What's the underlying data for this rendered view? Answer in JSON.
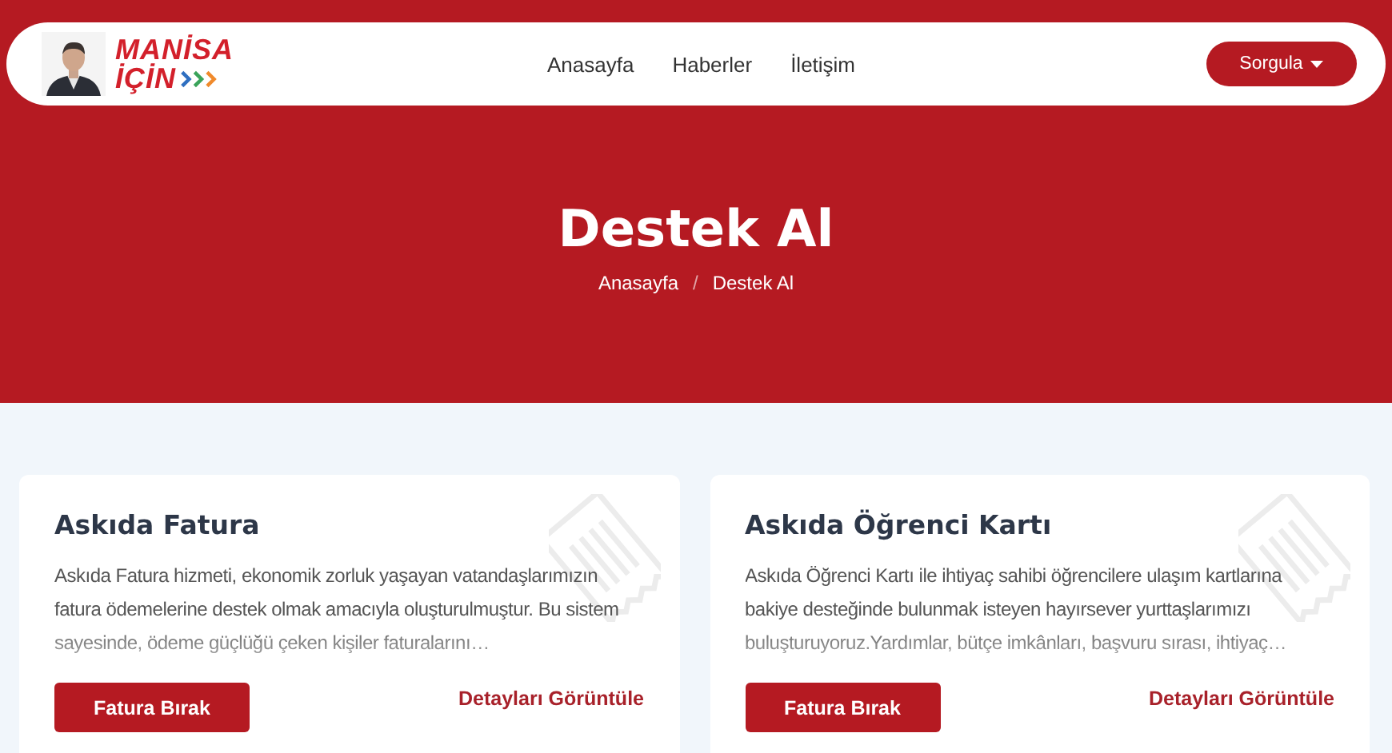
{
  "logo": {
    "line_1": "MANİSA",
    "line_2": "İÇİN"
  },
  "nav": [
    {
      "label": "Anasayfa"
    },
    {
      "label": "Haberler"
    },
    {
      "label": "İletişim"
    }
  ],
  "query_button": {
    "label": "Sorgula"
  },
  "hero": {
    "title": "Destek Al",
    "breadcrumb": [
      "Anasayfa",
      "Destek Al"
    ],
    "separator": "/"
  },
  "cards": [
    {
      "title": "Askıda Fatura",
      "text": "Askıda Fatura hizmeti, ekonomik zorluk yaşayan vatandaşlarımızın fatura ödemelerine destek olmak amacıyla oluşturulmuştur. Bu sistem sayesinde, ödeme güçlüğü çeken kişiler faturalarını…",
      "button": "Fatura Bırak",
      "link": "Detayları Görüntüle"
    },
    {
      "title": "Askıda Öğrenci Kartı",
      "text": "Askıda Öğrenci Kartı ile ihtiyaç sahibi öğrencilere ulaşım kartlarına bakiye desteğinde bulunmak isteyen hayırsever yurttaşlarımızı buluşturuyoruz.Yardımlar, bütçe imkânları, başvuru sırası, ihtiyaç…",
      "button": "Fatura Bırak",
      "link": "Detayları Görüntüle"
    }
  ]
}
